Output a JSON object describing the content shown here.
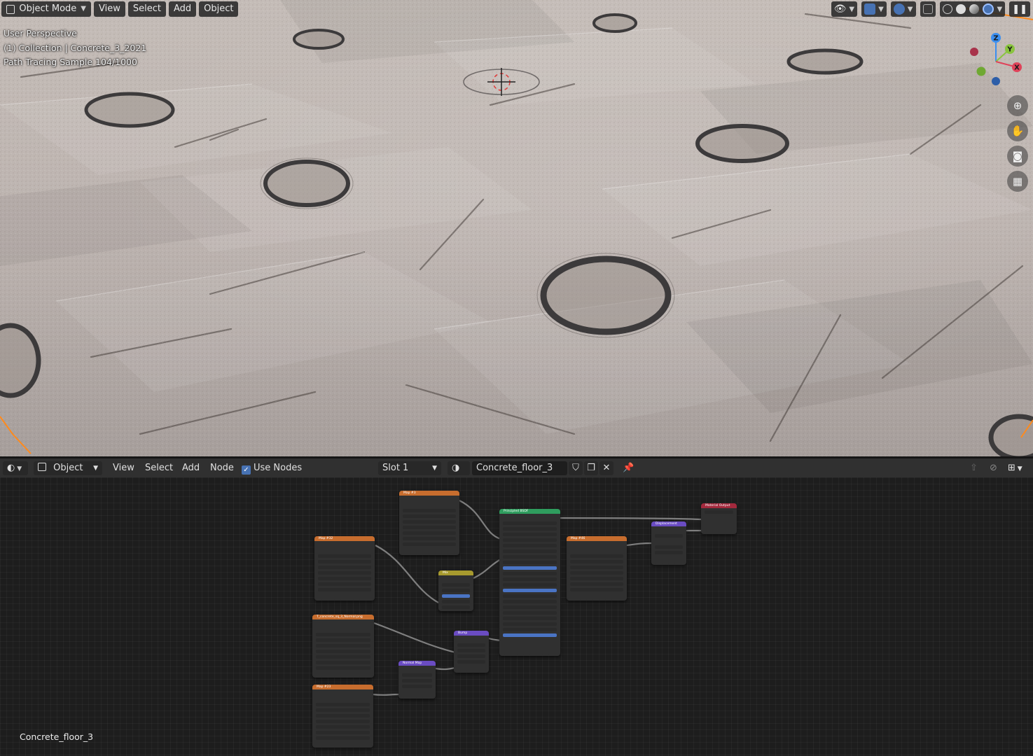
{
  "viewport": {
    "mode": "Object Mode",
    "menus": [
      "View",
      "Select",
      "Add",
      "Object"
    ],
    "overlay_lines": [
      "User Perspective",
      "(1) Collection | Concrete_3_2021",
      "Path Tracing Sample 104/1000"
    ],
    "gizmo_axes": {
      "z": "Z",
      "y": "Y",
      "x": "X"
    },
    "colors": {
      "x_axis": "#e0435a",
      "y_axis": "#8ac43f",
      "z_axis": "#3b8ff0",
      "selection_outline": "#ff8a1c"
    }
  },
  "node_header": {
    "type_dropdown": "Object",
    "menus": [
      "View",
      "Select",
      "Add",
      "Node"
    ],
    "use_nodes_label": "Use Nodes",
    "use_nodes_checked": true,
    "slot": "Slot 1",
    "material_name": "Concrete_floor_3"
  },
  "node_editor": {
    "material_label": "Concrete_floor_3",
    "nodes": [
      {
        "key": "tex_top",
        "title": "Map #3"
      },
      {
        "key": "tex_color",
        "title": "Map #32"
      },
      {
        "key": "tex_normal",
        "title": "T_concrete_sq_3_Normal.png"
      },
      {
        "key": "tex_rough",
        "title": "Map #23"
      },
      {
        "key": "mix",
        "title": "Mix"
      },
      {
        "key": "normal_map",
        "title": "Normal Map"
      },
      {
        "key": "bump",
        "title": "Bump"
      },
      {
        "key": "principled",
        "title": "Principled BSDF"
      },
      {
        "key": "tex_disp",
        "title": "Map #46"
      },
      {
        "key": "displacement",
        "title": "Displacement"
      },
      {
        "key": "output",
        "title": "Material Output"
      }
    ],
    "node_colors": {
      "texture": "#c76d2e",
      "color": "#a79a2e",
      "vector": "#6a4cc2",
      "shader": "#2f9d5e",
      "output": "#a3293d"
    }
  }
}
